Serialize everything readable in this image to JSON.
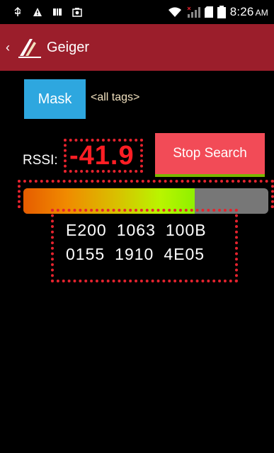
{
  "status_bar": {
    "icons": [
      "usb-icon",
      "warning-icon",
      "notification-icon",
      "photo-icon"
    ],
    "right_icons": [
      "wifi-icon",
      "signal-icon",
      "sim-icon",
      "battery-icon"
    ],
    "time": "8:26",
    "am_pm": "AM"
  },
  "action_bar": {
    "title": "Geiger"
  },
  "mask": {
    "button_label": "Mask",
    "filter_text": "<all tags>"
  },
  "rssi": {
    "label": "RSSI:",
    "value": "-41.9"
  },
  "stop_button": {
    "label": "Stop Search"
  },
  "signal_bar": {
    "level_percent": 70
  },
  "tag": {
    "line1": [
      "E200",
      "1063",
      "100B"
    ],
    "line2": [
      "0155",
      "1910",
      "4E05"
    ]
  },
  "colors": {
    "action_bar": "#9b1e2b",
    "mask_button": "#2ea7df",
    "stop_button": "#f24b57",
    "highlight_dots": "#e5232e",
    "rssi_value": "#ff1e24"
  }
}
